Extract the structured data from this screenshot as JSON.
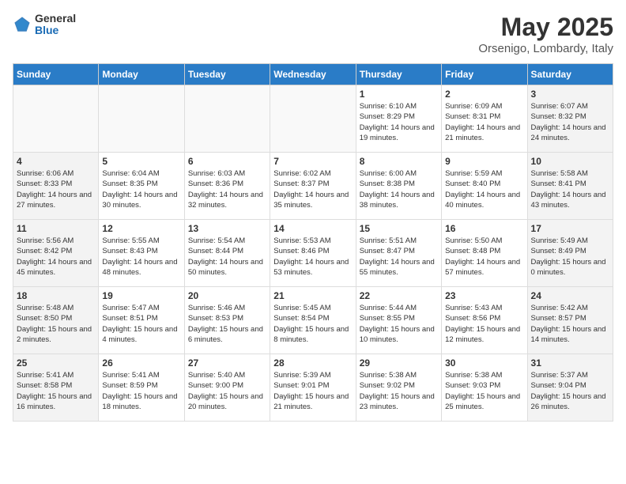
{
  "header": {
    "logo_general": "General",
    "logo_blue": "Blue",
    "month_year": "May 2025",
    "location": "Orsenigo, Lombardy, Italy"
  },
  "days_of_week": [
    "Sunday",
    "Monday",
    "Tuesday",
    "Wednesday",
    "Thursday",
    "Friday",
    "Saturday"
  ],
  "weeks": [
    [
      {
        "num": "",
        "detail": "",
        "empty": true
      },
      {
        "num": "",
        "detail": "",
        "empty": true
      },
      {
        "num": "",
        "detail": "",
        "empty": true
      },
      {
        "num": "",
        "detail": "",
        "empty": true
      },
      {
        "num": "1",
        "detail": "Sunrise: 6:10 AM\nSunset: 8:29 PM\nDaylight: 14 hours\nand 19 minutes."
      },
      {
        "num": "2",
        "detail": "Sunrise: 6:09 AM\nSunset: 8:31 PM\nDaylight: 14 hours\nand 21 minutes."
      },
      {
        "num": "3",
        "detail": "Sunrise: 6:07 AM\nSunset: 8:32 PM\nDaylight: 14 hours\nand 24 minutes."
      }
    ],
    [
      {
        "num": "4",
        "detail": "Sunrise: 6:06 AM\nSunset: 8:33 PM\nDaylight: 14 hours\nand 27 minutes."
      },
      {
        "num": "5",
        "detail": "Sunrise: 6:04 AM\nSunset: 8:35 PM\nDaylight: 14 hours\nand 30 minutes."
      },
      {
        "num": "6",
        "detail": "Sunrise: 6:03 AM\nSunset: 8:36 PM\nDaylight: 14 hours\nand 32 minutes."
      },
      {
        "num": "7",
        "detail": "Sunrise: 6:02 AM\nSunset: 8:37 PM\nDaylight: 14 hours\nand 35 minutes."
      },
      {
        "num": "8",
        "detail": "Sunrise: 6:00 AM\nSunset: 8:38 PM\nDaylight: 14 hours\nand 38 minutes."
      },
      {
        "num": "9",
        "detail": "Sunrise: 5:59 AM\nSunset: 8:40 PM\nDaylight: 14 hours\nand 40 minutes."
      },
      {
        "num": "10",
        "detail": "Sunrise: 5:58 AM\nSunset: 8:41 PM\nDaylight: 14 hours\nand 43 minutes."
      }
    ],
    [
      {
        "num": "11",
        "detail": "Sunrise: 5:56 AM\nSunset: 8:42 PM\nDaylight: 14 hours\nand 45 minutes."
      },
      {
        "num": "12",
        "detail": "Sunrise: 5:55 AM\nSunset: 8:43 PM\nDaylight: 14 hours\nand 48 minutes."
      },
      {
        "num": "13",
        "detail": "Sunrise: 5:54 AM\nSunset: 8:44 PM\nDaylight: 14 hours\nand 50 minutes."
      },
      {
        "num": "14",
        "detail": "Sunrise: 5:53 AM\nSunset: 8:46 PM\nDaylight: 14 hours\nand 53 minutes."
      },
      {
        "num": "15",
        "detail": "Sunrise: 5:51 AM\nSunset: 8:47 PM\nDaylight: 14 hours\nand 55 minutes."
      },
      {
        "num": "16",
        "detail": "Sunrise: 5:50 AM\nSunset: 8:48 PM\nDaylight: 14 hours\nand 57 minutes."
      },
      {
        "num": "17",
        "detail": "Sunrise: 5:49 AM\nSunset: 8:49 PM\nDaylight: 15 hours\nand 0 minutes."
      }
    ],
    [
      {
        "num": "18",
        "detail": "Sunrise: 5:48 AM\nSunset: 8:50 PM\nDaylight: 15 hours\nand 2 minutes."
      },
      {
        "num": "19",
        "detail": "Sunrise: 5:47 AM\nSunset: 8:51 PM\nDaylight: 15 hours\nand 4 minutes."
      },
      {
        "num": "20",
        "detail": "Sunrise: 5:46 AM\nSunset: 8:53 PM\nDaylight: 15 hours\nand 6 minutes."
      },
      {
        "num": "21",
        "detail": "Sunrise: 5:45 AM\nSunset: 8:54 PM\nDaylight: 15 hours\nand 8 minutes."
      },
      {
        "num": "22",
        "detail": "Sunrise: 5:44 AM\nSunset: 8:55 PM\nDaylight: 15 hours\nand 10 minutes."
      },
      {
        "num": "23",
        "detail": "Sunrise: 5:43 AM\nSunset: 8:56 PM\nDaylight: 15 hours\nand 12 minutes."
      },
      {
        "num": "24",
        "detail": "Sunrise: 5:42 AM\nSunset: 8:57 PM\nDaylight: 15 hours\nand 14 minutes."
      }
    ],
    [
      {
        "num": "25",
        "detail": "Sunrise: 5:41 AM\nSunset: 8:58 PM\nDaylight: 15 hours\nand 16 minutes."
      },
      {
        "num": "26",
        "detail": "Sunrise: 5:41 AM\nSunset: 8:59 PM\nDaylight: 15 hours\nand 18 minutes."
      },
      {
        "num": "27",
        "detail": "Sunrise: 5:40 AM\nSunset: 9:00 PM\nDaylight: 15 hours\nand 20 minutes."
      },
      {
        "num": "28",
        "detail": "Sunrise: 5:39 AM\nSunset: 9:01 PM\nDaylight: 15 hours\nand 21 minutes."
      },
      {
        "num": "29",
        "detail": "Sunrise: 5:38 AM\nSunset: 9:02 PM\nDaylight: 15 hours\nand 23 minutes."
      },
      {
        "num": "30",
        "detail": "Sunrise: 5:38 AM\nSunset: 9:03 PM\nDaylight: 15 hours\nand 25 minutes."
      },
      {
        "num": "31",
        "detail": "Sunrise: 5:37 AM\nSunset: 9:04 PM\nDaylight: 15 hours\nand 26 minutes."
      }
    ]
  ]
}
